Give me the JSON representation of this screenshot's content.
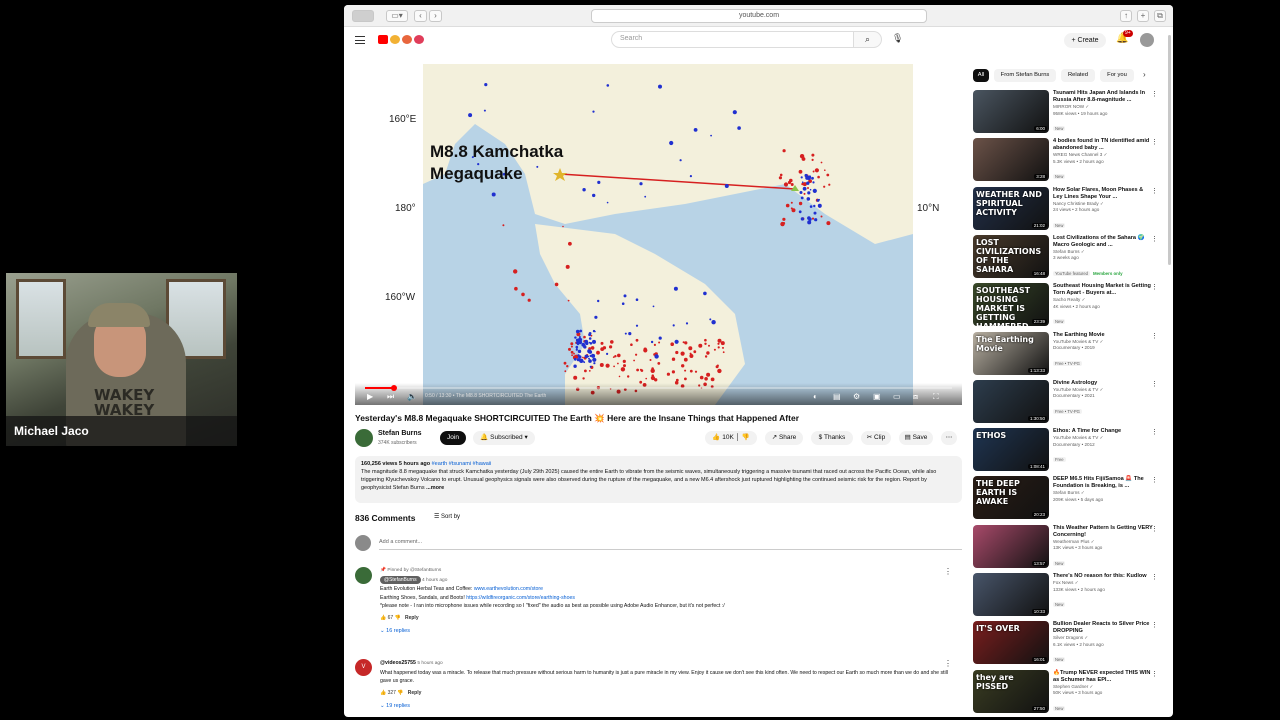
{
  "webcam": {
    "name": "Michael Jaco",
    "shirt_text": "WAKEY WAKEY"
  },
  "browser": {
    "url": "youtube.com"
  },
  "header": {
    "search_placeholder": "Search",
    "create_label": "Create",
    "notif_count": "9+"
  },
  "video": {
    "map_title": "M8.8 Kamchatka Megaquake",
    "coords": [
      "160°E",
      "180°",
      "160°W",
      "10°N"
    ],
    "time": "0:50 / 13:30",
    "chapter": "The M8.8 SHORTCIRCUITED The Earth",
    "progress_fraction": 0.05,
    "title": "Yesterday's M8.8 Megaquake SHORTCIRCUITED The Earth 💥 Here are the Insane Things that Happened After"
  },
  "channel": {
    "name": "Stefan Burns",
    "subs": "374K subscribers",
    "join": "Join",
    "subscribed": "Subscribed",
    "likes": "10K",
    "share": "Share",
    "thanks": "Thanks",
    "clip": "Clip",
    "save": "Save"
  },
  "description": {
    "meta": "160,256 views  5 hours ago",
    "tags": "#earth #tsunami #hawaii",
    "text": "The magnitude 8.8 megaquake that struck Kamchatka yesterday (July 29th 2025) caused the entire Earth to vibrate from the seismic waves, simultaneously triggering a massive tsunami that raced out across the Pacific Ocean, while also triggering Klyuchevskoy Volcano to erupt. Unusual geophysics signals were also observed during the rupture of the megaquake, and a new M6.4 aftershock just ruptured highlighting the continued seismic risk for the region. Report by geophysicist Stefan Burns",
    "more": "...more"
  },
  "comments": {
    "count_label": "836 Comments",
    "sort_label": "Sort by",
    "add_placeholder": "Add a comment...",
    "items": [
      {
        "pinned": "Pinned by @StefanBurns",
        "author": "@StefanBurns",
        "ago": "4 hours ago",
        "line1_text": "Earth Evolution Herbal Teas and Coffee: ",
        "line1_link": "www.earthevolution.com/store",
        "line2_text": "Earthing Shoes, Sandals, and Boots! ",
        "line2_link": "https://wildfireorganic.com/store/earthing-shoes",
        "line3_text": "*please note - I ran into microphone issues while recording so I \"fixed\" the audio as best as possible using Adobe Audio Enhancer, but it's not perfect :/",
        "likes": "67",
        "reply": "Reply",
        "replies": "16 replies"
      },
      {
        "author": "@videos25755",
        "ago": "5 hours ago",
        "text": "What happened today was a miracle. To release that much pressure without serious harm to humanity is just a pure miracle in my view. Enjoy it cause we don't see this kind often. We need to respect our Earth so much more than we do and she still gave us grace.",
        "likes": "327",
        "reply": "Reply",
        "replies": "19 replies"
      }
    ]
  },
  "sidebar": {
    "chips": [
      "All",
      "From Stefan Burns",
      "Related",
      "For you"
    ],
    "recs": [
      {
        "title": "Tsunami Hits Japan And Islands In Russia After 8.8-magnitude ...",
        "channel": "MIRROR NOW",
        "views": "958K views • 19 hours ago",
        "badge": "New",
        "duration": "6:00",
        "thumb_text": "",
        "thumb_color": "#4a5560"
      },
      {
        "title": "4 bodies found in TN identified amid abandoned baby ...",
        "channel": "WREG News Channel 3",
        "views": "5.3K views • 2 hours ago",
        "badge": "New",
        "duration": "3:28",
        "thumb_text": "",
        "thumb_color": "#6b5248"
      },
      {
        "title": "How Solar Flares, Moon Phases & Ley Lines Shape Your ...",
        "channel": "Nancy Christine Brady",
        "views": "24 views • 2 hours ago",
        "badge": "New",
        "duration": "21:02",
        "thumb_text": "WEATHER AND SPIRITUAL ACTIVITY",
        "thumb_color": "#22304a"
      },
      {
        "title": "Lost Civilizations of the Sahara 🌍 Macro Geologic and ...",
        "channel": "Stefan Burns",
        "views": "3 weeks ago",
        "badge": "YouTube featured",
        "member": "Members only",
        "duration": "16:48",
        "thumb_text": "LOST CIVILIZATIONS OF THE SAHARA",
        "thumb_color": "#4a3b2c"
      },
      {
        "title": "Southeast Housing Market is Getting Torn Apart - Buyers at...",
        "channel": "Sacho Realty",
        "views": "4K views • 2 hours ago",
        "badge": "New",
        "duration": "23:39",
        "thumb_text": "SOUTHEAST HOUSING MARKET IS GETTING HAMMERED",
        "thumb_color": "#3a4a2a"
      },
      {
        "title": "The Earthing Movie",
        "channel": "YouTube Movies & TV",
        "views": "Documentary • 2019",
        "badge": "Free • TV-PG",
        "duration": "1:13:33",
        "thumb_text": "The Earthing Movie",
        "thumb_color": "#b8b0a2"
      },
      {
        "title": "Divine Astrology",
        "channel": "YouTube Movies & TV",
        "views": "Documentary • 2021",
        "badge": "Free • TV-PG",
        "duration": "1:30:50",
        "thumb_text": "",
        "thumb_color": "#2d3d4d"
      },
      {
        "title": "Ethos: A Time for Change",
        "channel": "YouTube Movies & TV",
        "views": "Documentary • 2012",
        "badge": "Free",
        "duration": "1:08:41",
        "thumb_text": "ETHOS",
        "thumb_color": "#1f3552"
      },
      {
        "title": "DEEP M6.5 Hits Fiji/Samoa 🚨 The Foundation is Breaking, is ...",
        "channel": "Stefan Burns",
        "views": "209K views • 5 days ago",
        "badge": "",
        "duration": "20:23",
        "thumb_text": "THE DEEP EARTH IS AWAKE",
        "thumb_color": "#2b1e16"
      },
      {
        "title": "This Weather Pattern Is Getting VERY Concerning!",
        "channel": "Weatherman Plus",
        "views": "13K views • 3 hours ago",
        "badge": "New",
        "duration": "13:57",
        "thumb_text": "",
        "thumb_color": "#a84a6a"
      },
      {
        "title": "There's NO reason for this: Kudlow",
        "channel": "Fox News",
        "views": "133K views • 2 hours ago",
        "badge": "New",
        "duration": "10:33",
        "thumb_text": "",
        "thumb_color": "#48556a"
      },
      {
        "title": "Bullion Dealer Reacts to Silver Price DROPPING",
        "channel": "Silver Dragons",
        "views": "6.1K views • 2 hours ago",
        "badge": "New",
        "duration": "16:01",
        "thumb_text": "IT'S OVER",
        "thumb_color": "#7a1e1e"
      },
      {
        "title": "🔥Trump NEVER expected THIS WIN as Schumer has EPI...",
        "channel": "Stephen Gardner",
        "views": "50K views • 3 hours ago",
        "badge": "New",
        "duration": "27:50",
        "thumb_text": "they are PISSED",
        "thumb_color": "#3a3d22"
      }
    ]
  }
}
